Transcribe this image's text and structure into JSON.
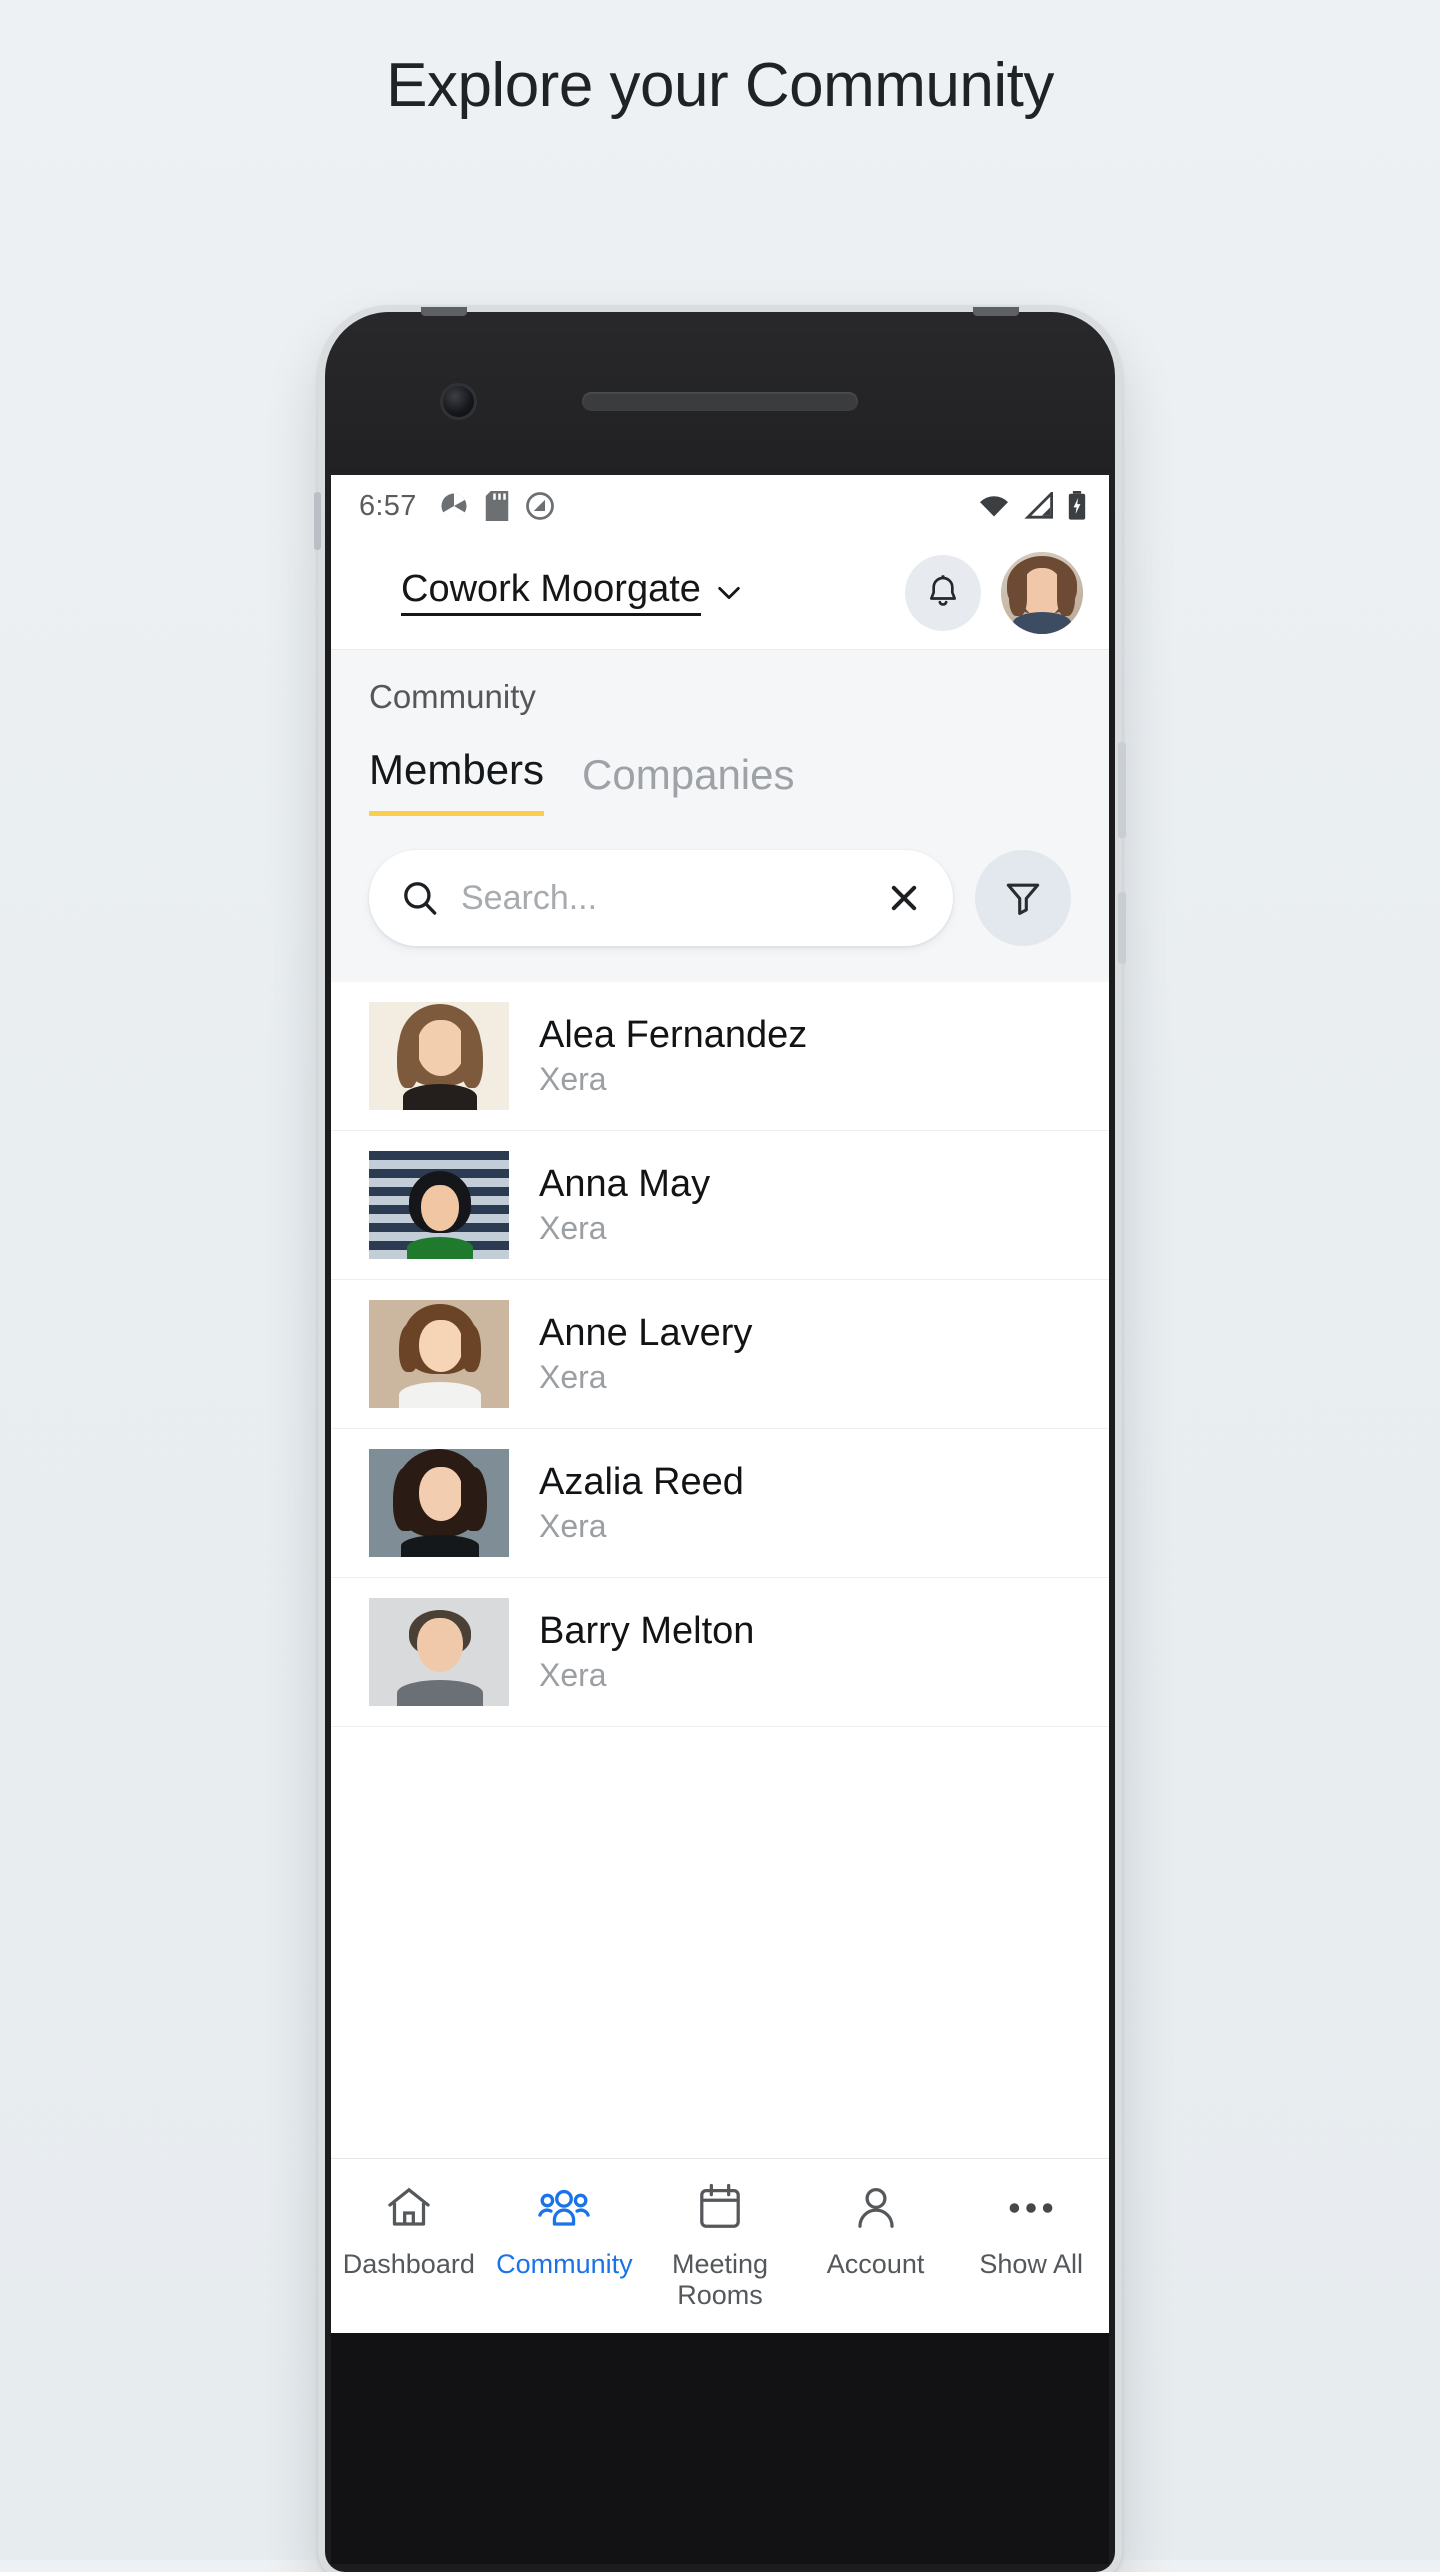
{
  "hero": {
    "title": "Explore your Community"
  },
  "statusbar": {
    "time": "6:57",
    "left_icons": [
      "camera-shutter-icon",
      "sd-card-icon",
      "do-not-disturb-icon"
    ],
    "right_icons": [
      "wifi-icon",
      "cell-signal-icon",
      "battery-icon"
    ]
  },
  "app_header": {
    "venue_name": "Cowork Moorgate",
    "venue_chevron": "chevron-down-icon",
    "bell": "notification-bell-icon",
    "avatar": "user-avatar"
  },
  "section": {
    "label": "Community",
    "tabs": [
      {
        "label": "Members",
        "active": true
      },
      {
        "label": "Companies",
        "active": false
      }
    ]
  },
  "search": {
    "placeholder": "Search...",
    "value": "",
    "clear_icon": "close-icon",
    "search_icon": "search-icon",
    "filter_icon": "filter-funnel-icon"
  },
  "members": [
    {
      "name": "Alea Fernandez",
      "company": "Xera"
    },
    {
      "name": "Anna May",
      "company": "Xera"
    },
    {
      "name": "Anne Lavery",
      "company": "Xera"
    },
    {
      "name": "Azalia Reed",
      "company": "Xera"
    },
    {
      "name": "Barry Melton",
      "company": "Xera"
    }
  ],
  "bottom_nav": [
    {
      "label": "Dashboard",
      "icon": "home-icon",
      "active": false
    },
    {
      "label": "Community",
      "icon": "people-group-icon",
      "active": true
    },
    {
      "label": "Meeting\nRooms",
      "icon": "calendar-icon",
      "active": false
    },
    {
      "label": "Account",
      "icon": "person-icon",
      "active": false
    },
    {
      "label": "Show All",
      "icon": "ellipsis-icon",
      "active": false
    }
  ],
  "colors": {
    "accent_blue": "#1a73e8",
    "tab_underline_yellow": "#fbcf4c",
    "page_bg": "#eef1f3",
    "subhead_bg": "#f4f6f8",
    "muted_text": "#9b9fa3"
  }
}
